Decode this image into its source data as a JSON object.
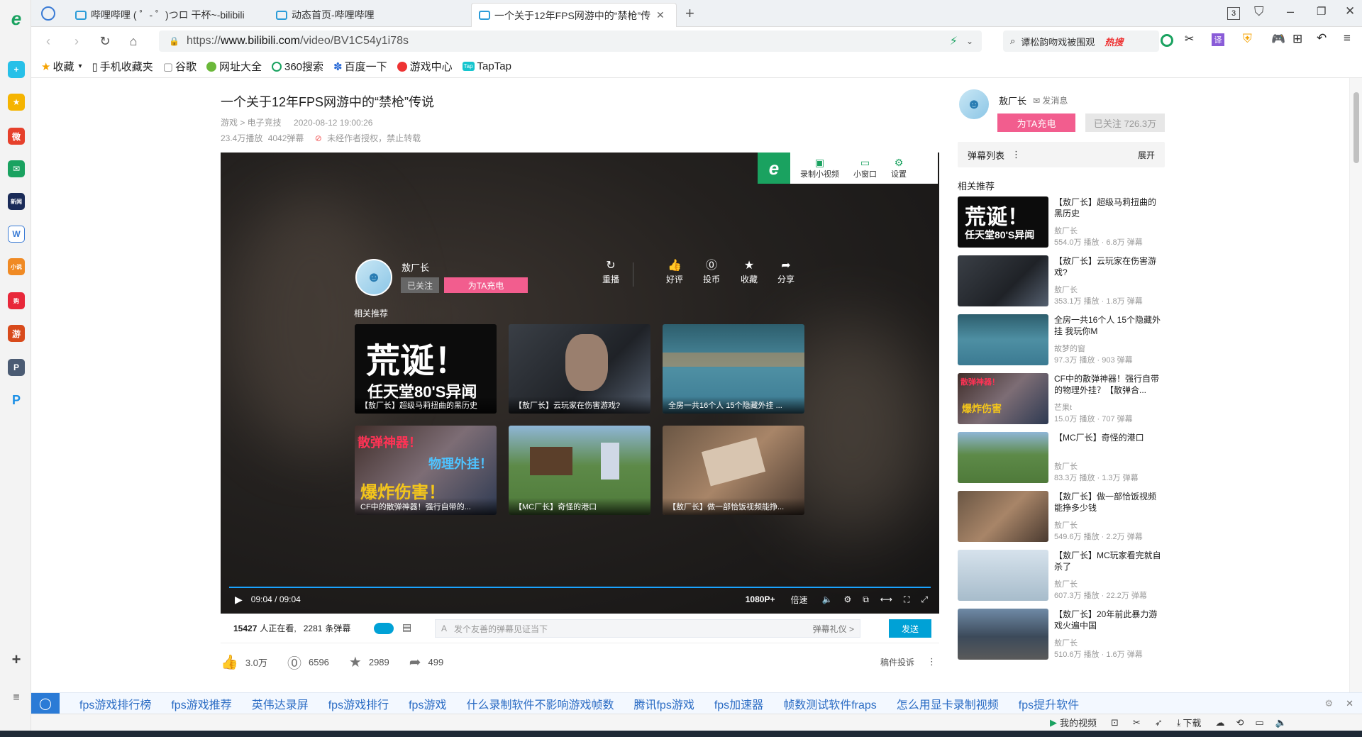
{
  "browser": {
    "tabs": [
      {
        "label": "哔哩哔哩 ( ゜- ゜)つロ 干杯~-bilibili"
      },
      {
        "label": "动态首页-哔哩哔哩"
      },
      {
        "label": "一个关于12年FPS网游中的“禁枪”传说"
      }
    ],
    "tab_count": "3",
    "url_prefix": "https://",
    "url_domain": "www.bilibili.com",
    "url_path": "/video/BV1C54y1i78s",
    "search_text": "谭松韵吻戏被围观",
    "hot_label": "热搜",
    "icons": [
      "back-icon",
      "forward-icon",
      "reload-icon",
      "home-icon",
      "search-icon"
    ]
  },
  "bookmarks": [
    {
      "label": "收藏"
    },
    {
      "label": "手机收藏夹"
    },
    {
      "label": "谷歌"
    },
    {
      "label": "网址大全"
    },
    {
      "label": "360搜索"
    },
    {
      "label": "百度一下"
    },
    {
      "label": "游戏中心"
    },
    {
      "label": "TapTap"
    }
  ],
  "video": {
    "title": "一个关于12年FPS网游中的“禁枪”传说",
    "category": "游戏 > 电子竞技",
    "date": "2020-08-12 19:00:26",
    "plays": "23.4万播放",
    "danmaku_count": "4042弹幕",
    "notice": "未经作者授权，禁止转载"
  },
  "player_toolbar": {
    "record": "录制小视频",
    "mini": "小窗口",
    "settings": "设置"
  },
  "endcard": {
    "up_name": "敖厂长",
    "followed": "已关注",
    "charge": "为TA充电",
    "replay": "重播",
    "like": "好评",
    "coin": "投币",
    "fav": "收藏",
    "share": "分享",
    "related_label": "相关推荐",
    "cards": [
      {
        "caption": "【敖厂长】超级马莉扭曲的黑历史",
        "overlay1": "荒诞！",
        "overlay2": "任天堂80'S异闻"
      },
      {
        "caption": "【敖厂长】云玩家在伤害游戏?"
      },
      {
        "caption": "全房一共16个人 15个隐藏外挂 ..."
      },
      {
        "caption": "CF中的散弹神器！强行自带的...",
        "overlay1": "散弹神器！",
        "overlay2": "物理外挂！",
        "overlay3": "爆炸伤害！"
      },
      {
        "caption": "【MC厂长】奇怪的港口"
      },
      {
        "caption": "【敖厂长】做一部恰饭视频能挣..."
      }
    ]
  },
  "controls": {
    "time": "09:04 / 09:04",
    "quality": "1080P+",
    "speed": "倍速"
  },
  "danmaku_bar": {
    "watching_count": "15427",
    "watching_label": "人正在看,",
    "dm_count": "2281",
    "dm_label": "条弹幕",
    "placeholder": "发个友善的弹幕见证当下",
    "etiquette": "弹幕礼仪 >",
    "send": "发送"
  },
  "actions": {
    "like": "3.0万",
    "coin": "6596",
    "fav": "2989",
    "share": "499",
    "report": "稿件投诉"
  },
  "uploader": {
    "name": "敖厂长",
    "message": "发消息",
    "charge": "为TA充电",
    "followed": "已关注 726.3万"
  },
  "danmaku_list": {
    "label": "弹幕列表",
    "expand": "展开"
  },
  "related": {
    "label": "相关推荐",
    "items": [
      {
        "title": "【敖厂长】超级马莉扭曲的黑历史",
        "up": "敖厂长",
        "stats": "554.0万 播放 · 6.8万 弹幕",
        "overlay1": "荒诞！",
        "overlay2": "任天堂80'S异闻"
      },
      {
        "title": "【敖厂长】云玩家在伤害游戏?",
        "up": "敖厂长",
        "stats": "353.1万 播放 · 1.8万 弹幕"
      },
      {
        "title": "全房一共16个人 15个隐藏外挂 我玩你M",
        "up": "故梦的窗",
        "stats": "97.3万 播放 · 903 弹幕"
      },
      {
        "title": "CF中的散弹神器！强行自带的物理外挂？【散弹合...",
        "up": "芒果t",
        "stats": "15.0万 播放 · 707 弹幕",
        "overlay1": "散弹神器！",
        "overlay3": "爆炸伤害"
      },
      {
        "title": "【MC厂长】奇怪的港口",
        "up": "敖厂长",
        "stats": "83.3万 播放 · 1.3万 弹幕"
      },
      {
        "title": "【敖厂长】做一部恰饭视频能挣多少钱",
        "up": "敖厂长",
        "stats": "549.6万 播放 · 2.2万 弹幕"
      },
      {
        "title": "【敖厂长】MC玩家看完就自杀了",
        "up": "敖厂长",
        "stats": "607.3万 播放 · 22.2万 弹幕"
      },
      {
        "title": "【敖厂长】20年前此暴力游戏火遍中国",
        "up": "敖厂长",
        "stats": "510.6万 播放 · 1.6万 弹幕"
      }
    ]
  },
  "hot_searches": [
    "fps游戏排行榜",
    "fps游戏推荐",
    "英伟达录屏",
    "fps游戏排行",
    "fps游戏",
    "什么录制软件不影响游戏帧数",
    "腾讯fps游戏",
    "fps加速器",
    "帧数测试软件fraps",
    "怎么用显卡录制视频",
    "fps提升软件"
  ],
  "statusbar": {
    "my_video": "我的视频",
    "download": "下载"
  }
}
